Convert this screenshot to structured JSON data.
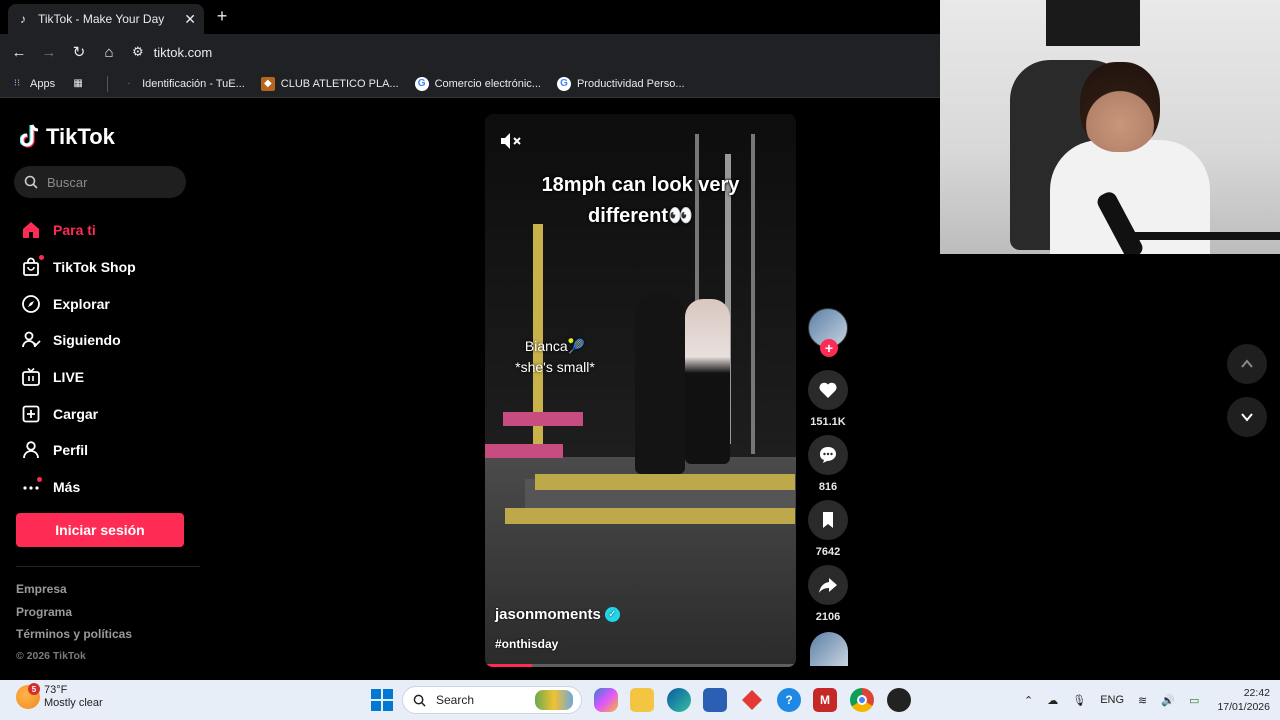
{
  "browser": {
    "tab_title": "TikTok - Make Your Day",
    "address": "tiktok.com",
    "bookmarks": [
      {
        "label": "Apps"
      },
      {
        "label": "Identificación - TuE..."
      },
      {
        "label": "CLUB ATLETICO PLA..."
      },
      {
        "label": "Comercio electrónic..."
      },
      {
        "label": "Productividad Perso..."
      }
    ]
  },
  "sidebar": {
    "logo_text": "TikTok",
    "search_placeholder": "Buscar",
    "nav": [
      {
        "label": "Para ti",
        "icon": "home-icon",
        "active": true
      },
      {
        "label": "TikTok Shop",
        "icon": "shop-bag-icon"
      },
      {
        "label": "Explorar",
        "icon": "compass-icon"
      },
      {
        "label": "Siguiendo",
        "icon": "user-following-icon"
      },
      {
        "label": "LIVE",
        "icon": "live-tv-icon"
      },
      {
        "label": "Cargar",
        "icon": "upload-plus-icon"
      },
      {
        "label": "Perfil",
        "icon": "profile-icon"
      },
      {
        "label": "Más",
        "icon": "more-dots-icon"
      }
    ],
    "login_label": "Iniciar sesión",
    "footer": {
      "links": [
        "Empresa",
        "Programa",
        "Términos y políticas"
      ],
      "copyright": "© 2026 TikTok"
    }
  },
  "video": {
    "caption_line1": "18mph can look very",
    "caption_line2": "different👀",
    "overlay_line1": "Bianca🎾",
    "overlay_line2": "*she's small*",
    "author": "jasonmoments",
    "hashtag": "#onthisday",
    "progress": 0.15
  },
  "actions": {
    "likes": "151.1K",
    "comments": "816",
    "saves": "7642",
    "shares": "2106"
  },
  "taskbar": {
    "temperature": "73°F",
    "weather": "Mostly clear",
    "weather_badge": "5",
    "search_label": "Search",
    "language": "ENG",
    "time": "22:42",
    "date": "17/01/2026"
  },
  "colors": {
    "accent": "#fe2c55",
    "verified": "#20d5ec",
    "chrome_bg": "#202124"
  }
}
